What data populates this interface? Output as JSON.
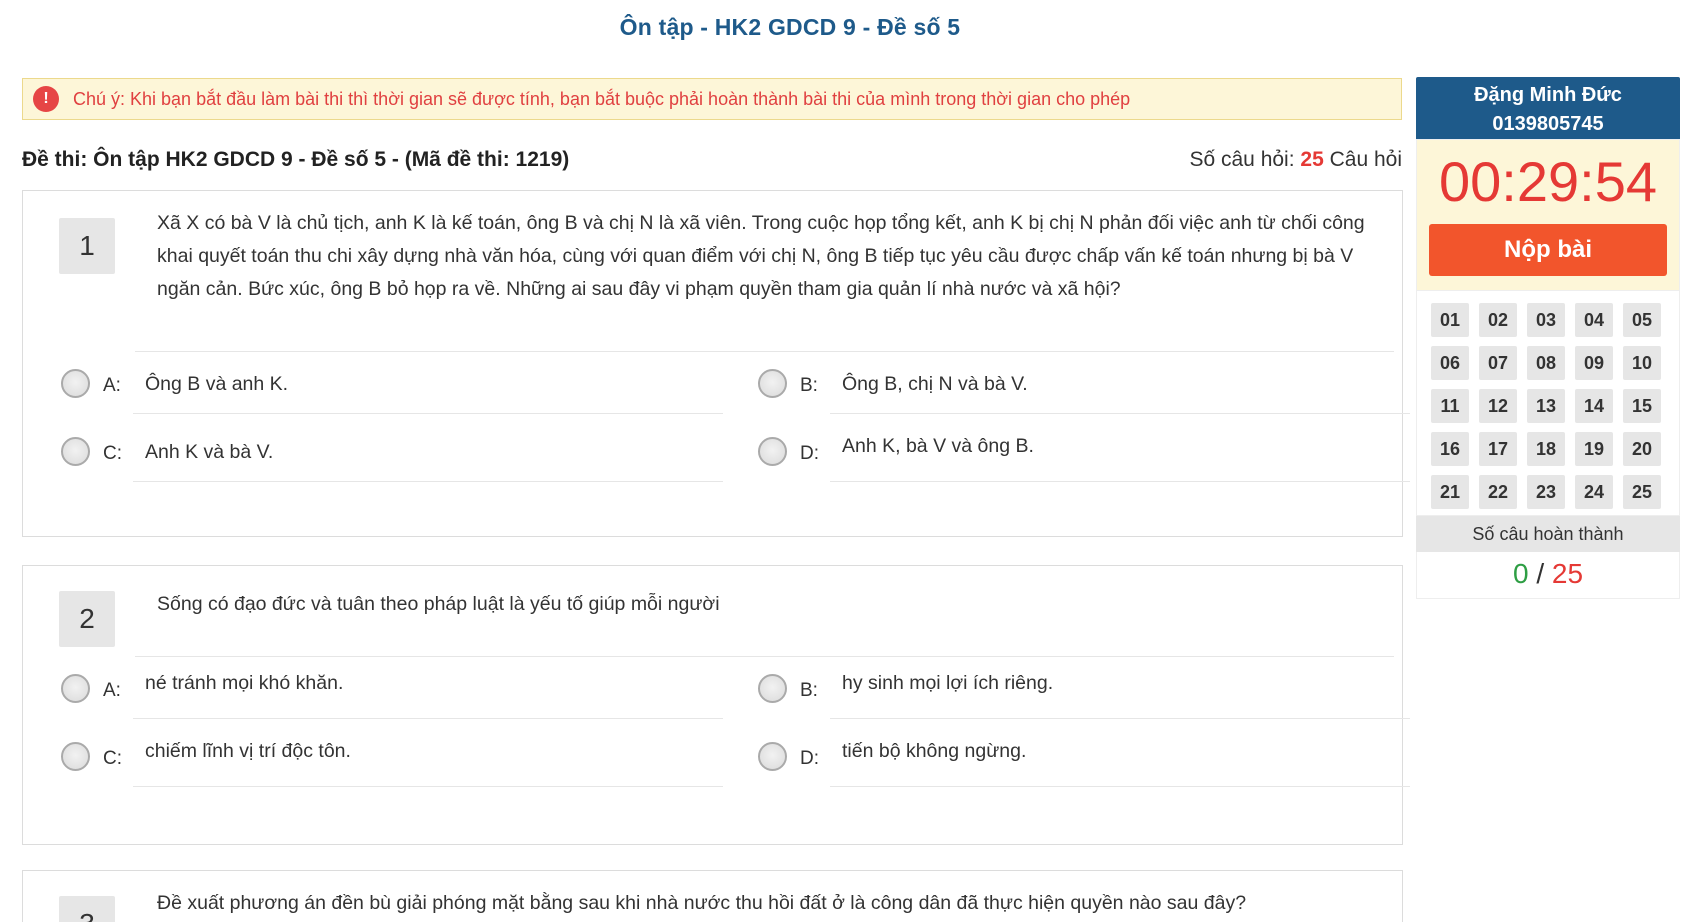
{
  "page": {
    "title": "Ôn tập - HK2 GDCD 9 - Đề số 5"
  },
  "notice": {
    "icon": "warning-icon",
    "text": "Chú ý: Khi bạn bắt đầu làm bài thi thì thời gian sẽ được tính, bạn bắt buộc phải hoàn thành bài thi của mình trong thời gian cho phép"
  },
  "exam": {
    "title": "Đề thi: Ôn tập HK2 GDCD 9 - Đề số 5 - (Mã đề thi: 1219)",
    "count_label": "Số câu hỏi:",
    "count": "25",
    "count_unit": "Câu hỏi"
  },
  "questions": [
    {
      "number": "1",
      "text": "Xã X có bà V là chủ tịch, anh K là kế toán, ông B và chị N là xã viên. Trong cuộc họp tổng kết, anh K bị chị N phản đối việc anh từ chối công khai quyết toán thu chi xây dựng nhà văn hóa, cùng với quan điểm với chị N, ông B tiếp tục yêu cầu được chấp vấn kế toán nhưng bị bà V ngăn cản. Bức xúc, ông B bỏ họp ra về. Những ai sau đây vi phạm quyền tham gia quản lí nhà nước và xã hội?",
      "options": [
        {
          "letter": "A:",
          "text": "Ông B và anh K."
        },
        {
          "letter": "B:",
          "text": "Ông B, chị N và bà V."
        },
        {
          "letter": "C:",
          "text": "Anh K và bà V."
        },
        {
          "letter": "D:",
          "text": "Anh K, bà V và ông B."
        }
      ]
    },
    {
      "number": "2",
      "text": "Sống có đạo đức và tuân theo pháp luật là yếu tố giúp mỗi người",
      "options": [
        {
          "letter": "A:",
          "text": "né tránh mọi khó khăn."
        },
        {
          "letter": "B:",
          "text": "hy sinh mọi lợi ích riêng."
        },
        {
          "letter": "C:",
          "text": "chiếm lĩnh vị trí độc tôn."
        },
        {
          "letter": "D:",
          "text": "tiến bộ không ngừng."
        }
      ]
    },
    {
      "number": "3",
      "text": "Đề xuất phương án đền bù giải phóng mặt bằng sau khi nhà nước thu hồi đất ở là công dân đã thực hiện quyền nào sau đây?"
    }
  ],
  "sidebar": {
    "user_name": "Đặng Minh Đức",
    "user_id": "0139805745",
    "timer": "00:29:54",
    "submit_label": "Nộp bài",
    "question_numbers": [
      "01",
      "02",
      "03",
      "04",
      "05",
      "06",
      "07",
      "08",
      "09",
      "10",
      "11",
      "12",
      "13",
      "14",
      "15",
      "16",
      "17",
      "18",
      "19",
      "20",
      "21",
      "22",
      "23",
      "24",
      "25"
    ],
    "done_label": "Số câu hoàn thành",
    "done_count": "0",
    "done_separator": "/",
    "done_total": "25"
  }
}
